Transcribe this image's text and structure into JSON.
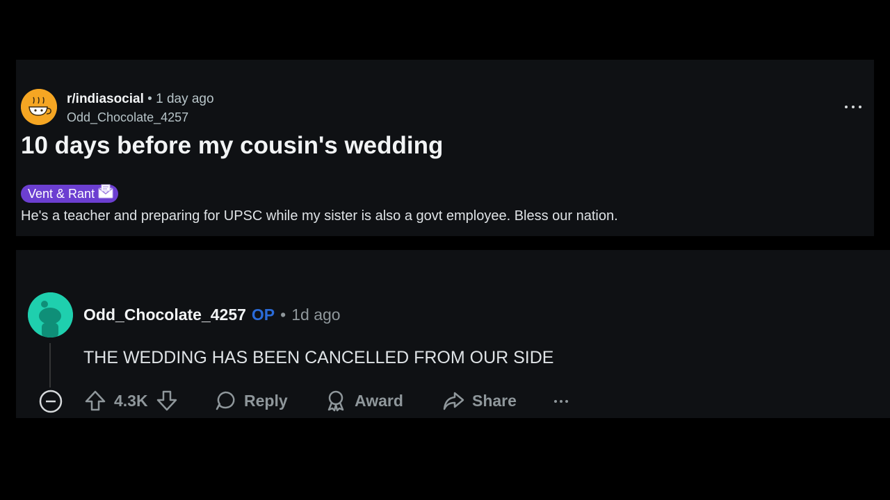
{
  "post": {
    "subreddit": "r/indiasocial",
    "separator": "•",
    "time": "1 day ago",
    "author": "Odd_Chocolate_4257",
    "title": "10 days before my cousin's wedding",
    "flair": "Vent & Rant",
    "body": "He's a teacher and preparing for UPSC while my sister is also a govt employee. Bless our nation."
  },
  "comment": {
    "author": "Odd_Chocolate_4257",
    "op_label": "OP",
    "separator": "•",
    "time": "1d ago",
    "body": "THE WEDDING HAS BEEN CANCELLED FROM OUR SIDE",
    "score": "4.3K",
    "reply_label": "Reply",
    "award_label": "Award",
    "share_label": "Share"
  },
  "colors": {
    "flair_bg": "#6c3fd1",
    "op": "#2a6bd8",
    "subreddit_avatar": "#f5a623",
    "user_avatar": "#1fcfae"
  },
  "icons": [
    "overflow-menu-icon",
    "collapse-icon",
    "upvote-icon",
    "downvote-icon",
    "reply-icon",
    "award-icon",
    "share-icon",
    "more-icon"
  ]
}
